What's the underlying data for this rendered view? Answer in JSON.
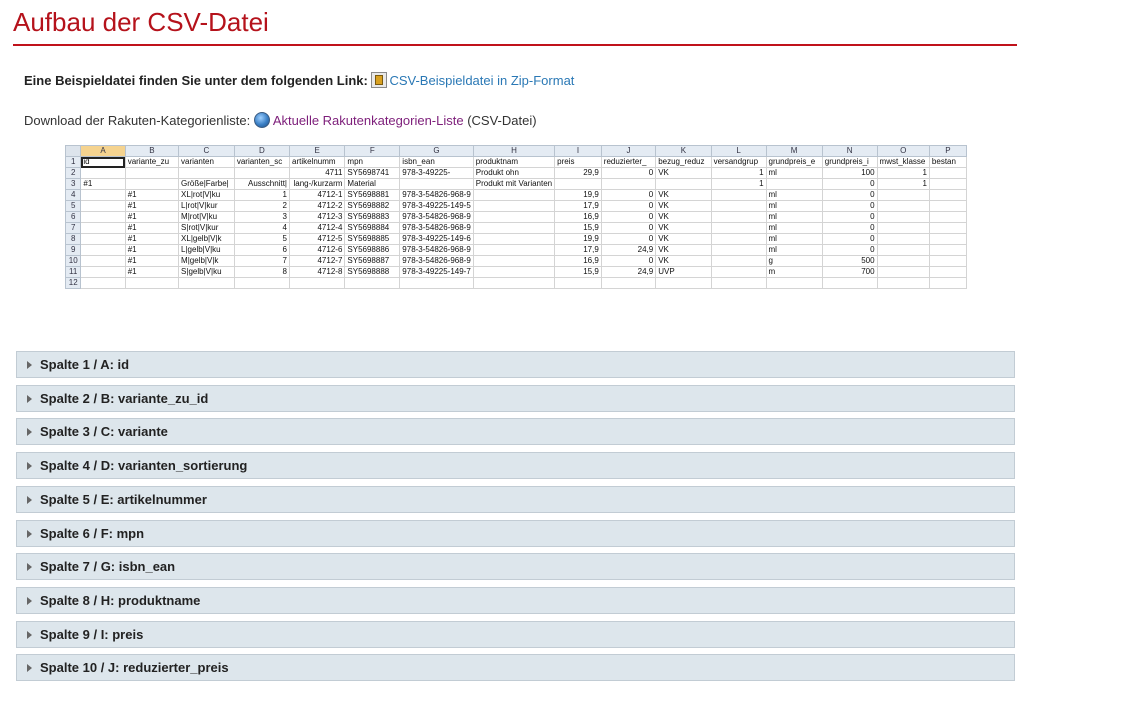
{
  "page_title": "Aufbau der CSV-Datei",
  "example_line": {
    "text": "Eine Beispieldatei finden Sie unter dem folgenden Link:",
    "icon": "zip-file-icon",
    "link": "CSV-Beispieldatei in Zip-Format"
  },
  "download_line": {
    "text": "Download der Rakuten-Kategorienliste:",
    "icon": "globe-icon",
    "link": "Aktuelle Rakutenkategorien-Liste",
    "suffix": "(CSV-Datei)"
  },
  "spreadsheet": {
    "columns": [
      "A",
      "B",
      "C",
      "D",
      "E",
      "F",
      "G",
      "H",
      "I",
      "J",
      "K",
      "L",
      "M",
      "N",
      "O",
      "P"
    ],
    "rows": [
      [
        "id",
        "variante_zu",
        "varianten",
        "varianten_sc",
        "artikelnumm",
        "mpn",
        "isbn_ean",
        "produktnam",
        "preis",
        "reduzierter_",
        "bezug_reduz",
        "versandgrup",
        "grundpreis_e",
        "grundpreis_i",
        "mwst_klasse",
        "bestan"
      ],
      [
        "",
        "",
        "",
        "",
        "4711",
        "SY5698741",
        "978-3-49225-",
        "Produkt ohn",
        "29,9",
        "0",
        "VK",
        "1",
        "ml",
        "100",
        "1",
        ""
      ],
      [
        "#1",
        "",
        "Größe|Farbe|",
        "Ausschnitt|",
        "lang-/kurzarm",
        "Material",
        "",
        "Produkt mit Varianten",
        "",
        "",
        "",
        "1",
        "",
        "0",
        "1",
        ""
      ],
      [
        "",
        "#1",
        "XL|rot|V|ku",
        "1",
        "4712-1",
        "SY5698881",
        "978-3-54826-968-9",
        "",
        "19,9",
        "0",
        "VK",
        "",
        "ml",
        "0",
        "",
        ""
      ],
      [
        "",
        "#1",
        "L|rot|V|kur",
        "2",
        "4712-2",
        "SY5698882",
        "978-3-49225-149-5",
        "",
        "17,9",
        "0",
        "VK",
        "",
        "ml",
        "0",
        "",
        ""
      ],
      [
        "",
        "#1",
        "M|rot|V|ku",
        "3",
        "4712-3",
        "SY5698883",
        "978-3-54826-968-9",
        "",
        "16,9",
        "0",
        "VK",
        "",
        "ml",
        "0",
        "",
        ""
      ],
      [
        "",
        "#1",
        "S|rot|V|kur",
        "4",
        "4712-4",
        "SY5698884",
        "978-3-54826-968-9",
        "",
        "15,9",
        "0",
        "VK",
        "",
        "ml",
        "0",
        "",
        ""
      ],
      [
        "",
        "#1",
        "XL|gelb|V|k",
        "5",
        "4712-5",
        "SY5698885",
        "978-3-49225-149-6",
        "",
        "19,9",
        "0",
        "VK",
        "",
        "ml",
        "0",
        "",
        ""
      ],
      [
        "",
        "#1",
        "L|gelb|V|ku",
        "6",
        "4712-6",
        "SY5698886",
        "978-3-54826-968-9",
        "",
        "17,9",
        "24,9",
        "VK",
        "",
        "ml",
        "0",
        "",
        ""
      ],
      [
        "",
        "#1",
        "M|gelb|V|k",
        "7",
        "4712-7",
        "SY5698887",
        "978-3-54826-968-9",
        "",
        "16,9",
        "0",
        "VK",
        "",
        "g",
        "500",
        "",
        ""
      ],
      [
        "",
        "#1",
        "S|gelb|V|ku",
        "8",
        "4712-8",
        "SY5698888",
        "978-3-49225-149-7",
        "",
        "15,9",
        "24,9",
        "UVP",
        "",
        "m",
        "700",
        "",
        ""
      ],
      [
        "",
        "",
        "",
        "",
        "",
        "",
        "",
        "",
        "",
        "",
        "",
        "",
        "",
        "",
        "",
        ""
      ]
    ]
  },
  "accordion": [
    "Spalte 1 / A: id",
    "Spalte 2 / B: variante_zu_id",
    "Spalte 3 / C: variante",
    "Spalte 4 / D: varianten_sortierung",
    "Spalte 5 / E: artikelnummer",
    "Spalte 6 / F: mpn",
    "Spalte 7 / G: isbn_ean",
    "Spalte 8 / H: produktname",
    "Spalte 9 / I: preis",
    "Spalte 10 / J: reduzierter_preis"
  ],
  "colors": {
    "title": "#b5121b",
    "link_blue": "#2a78b5",
    "link_purple": "#7d1e7a",
    "accordion_bg": "#dde6ec"
  }
}
